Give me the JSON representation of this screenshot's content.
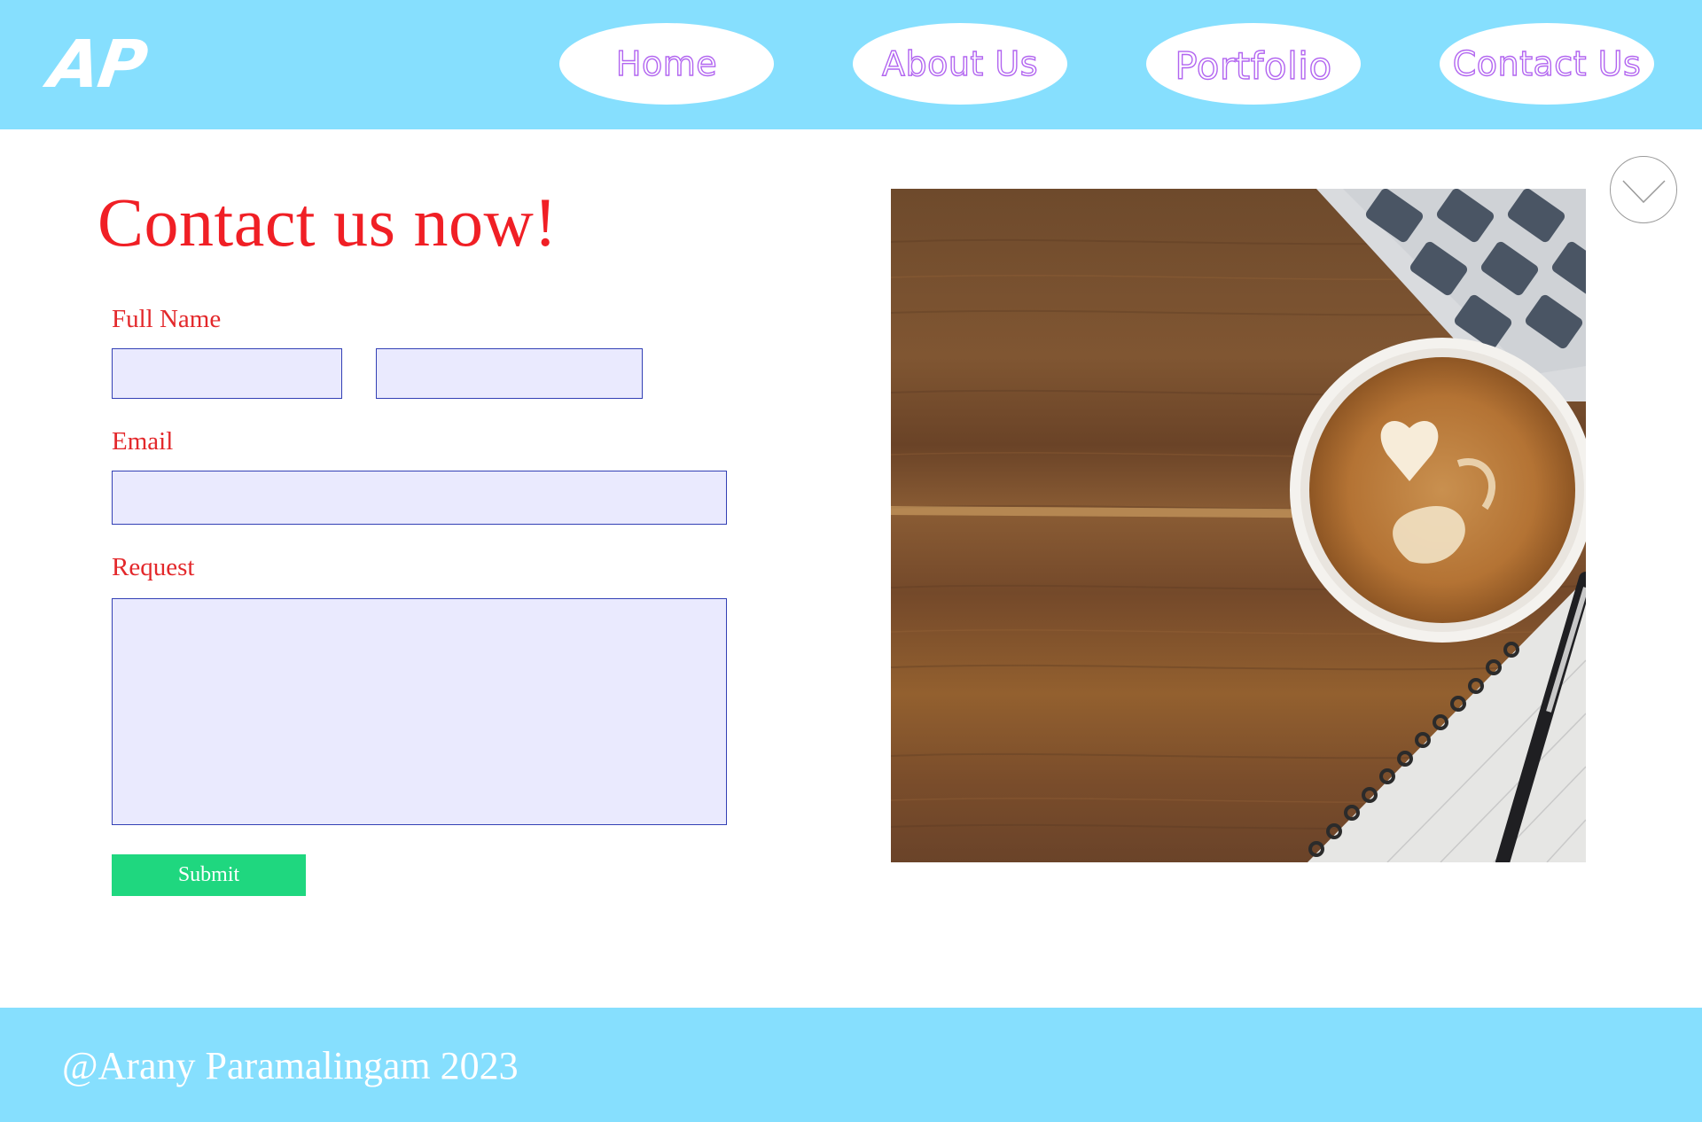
{
  "header": {
    "logo_text": "AP",
    "nav": {
      "home": "Home",
      "about": "About Us",
      "portfolio": "Portfolio",
      "contact": "Contact Us"
    }
  },
  "main": {
    "title": "Contact us now!",
    "form": {
      "full_name_label": "Full Name",
      "email_label": "Email",
      "request_label": "Request",
      "first_name_value": "",
      "last_name_value": "",
      "email_value": "",
      "request_value": "",
      "submit_label": "Submit"
    },
    "scroll_icon": "chevron-down-icon",
    "photo_subject": "coffee-desk-photo"
  },
  "footer": {
    "copyright": "@Arany Paramalingam 2023"
  },
  "colors": {
    "header_bg": "#86dffe",
    "nav_text_outline": "#b265f0",
    "title_red": "#f01f25",
    "input_bg": "#eaeafe",
    "input_border": "#3340b5",
    "submit_bg": "#1fd77f"
  }
}
